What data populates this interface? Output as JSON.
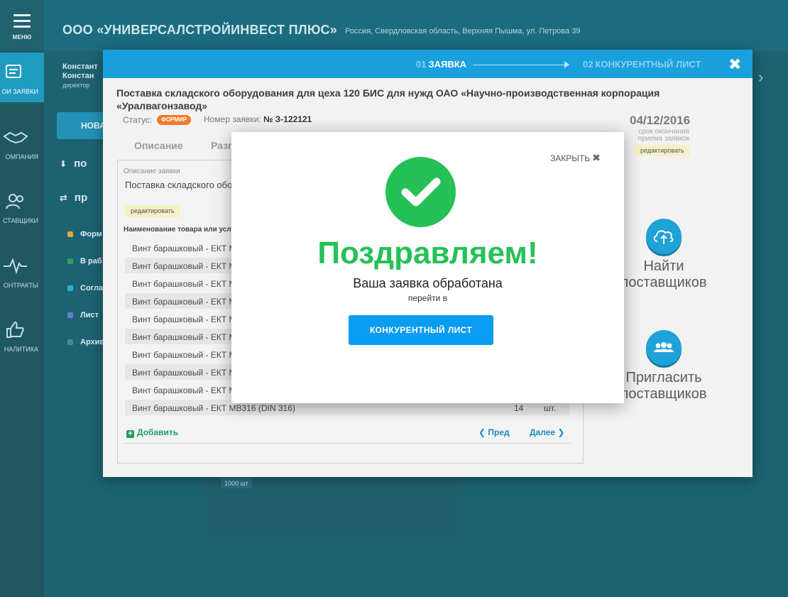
{
  "sidebar": {
    "menu_label": "МЕНЮ",
    "items": [
      {
        "label": "ОИ ЗАЯВКИ",
        "icon": "applications-icon",
        "active": true
      },
      {
        "label": "ОМПАНИЯ",
        "icon": "handshake-icon",
        "active": false
      },
      {
        "label": "СТАВЩИКИ",
        "icon": "users-icon",
        "active": false
      },
      {
        "label": "ОНТРАКТЫ",
        "icon": "pulse-icon",
        "active": false
      },
      {
        "label": "НАЛИТИКА",
        "icon": "thumbs-up-icon",
        "active": false
      }
    ]
  },
  "header": {
    "company": "ООО «УНИВЕРСАЛСТРОЙИНВЕСТ ПЛЮС»",
    "address": "Россия, Свердловская область, Верхняя Пышма, ул. Петрова 39",
    "user_line1": "Констант",
    "user_line2": "Констан",
    "user_role": "директор"
  },
  "background": {
    "new_button": "НОВА",
    "list_item_1": "по",
    "list_item_2": "пр",
    "statuses": [
      {
        "label": "Форм",
        "color": "#e0a43a"
      },
      {
        "label": "В раб",
        "color": "#2fa05f"
      },
      {
        "label": "Согла",
        "color": "#23b3d3"
      },
      {
        "label": "Лист",
        "color": "#6c7bd3"
      },
      {
        "label": "Архив",
        "color": "#3b8d95"
      }
    ],
    "qty_badge": "1000 шт"
  },
  "wizard": {
    "step1_num": "01",
    "step1_label": "ЗАЯВКА",
    "step2_num": "02",
    "step2_label": "КОНКУРЕНТНЫЙ ЛИСТ",
    "title": "Поставка складского оборудования для цеха 120 БИС для нужд ОАО «Научно-производственная корпорация «Уралвагонзавод»",
    "status_label": "Статус:",
    "status_value": "ФОРМИР",
    "number_label": "Номер заявки:",
    "number_value": "№ З-122121",
    "deadline_date": "04/12/2016",
    "deadline_caption": "срок окончания приема заявкок",
    "edit_label": "редактировать",
    "tab_description": "Описание",
    "tab_second": "Разг",
    "form": {
      "caption": "Описание заявки",
      "text": "Поставка складского обо корпорация «Уралвагонз",
      "edit_label": "редактировать",
      "columns_header": "Наименование товара или усл",
      "rows": [
        {
          "name": "Винт барашковый - ЕКТ M",
          "qty": "",
          "unit": ""
        },
        {
          "name": "Винт барашковый - ЕКТ M",
          "qty": "",
          "unit": ""
        },
        {
          "name": "Винт барашковый - ЕКТ M",
          "qty": "",
          "unit": ""
        },
        {
          "name": "Винт барашковый - ЕКТ M",
          "qty": "",
          "unit": ""
        },
        {
          "name": "Винт барашковый - ЕКТ M",
          "qty": "",
          "unit": ""
        },
        {
          "name": "Винт барашковый - ЕКТ M",
          "qty": "",
          "unit": ""
        },
        {
          "name": "Винт барашковый - ЕКТ M",
          "qty": "",
          "unit": ""
        },
        {
          "name": "Винт барашковый - ЕКТ M",
          "qty": "",
          "unit": ""
        },
        {
          "name": "Винт барашковый - ЕКТ M",
          "qty": "",
          "unit": ""
        },
        {
          "name": "Винт барашковый - ЕКТ МВ316 (DIN 316)",
          "qty": "14",
          "unit": "шт."
        }
      ],
      "add_label": "Добавить",
      "prev_label": "Пред",
      "next_label": "Далее"
    },
    "find_suppliers": "Найти поставщиков",
    "invite_suppliers": "Пригласить поставщиков"
  },
  "success": {
    "close_label": "ЗАКРЫТЬ",
    "title": "Поздравляем!",
    "subtitle": "Ваша заявка обработана",
    "go_text": "перейти в",
    "button_label": "КОНКУРЕНТНЫЙ ЛИСТ",
    "accent_color": "#25c157",
    "button_color": "#0a9cf0"
  }
}
